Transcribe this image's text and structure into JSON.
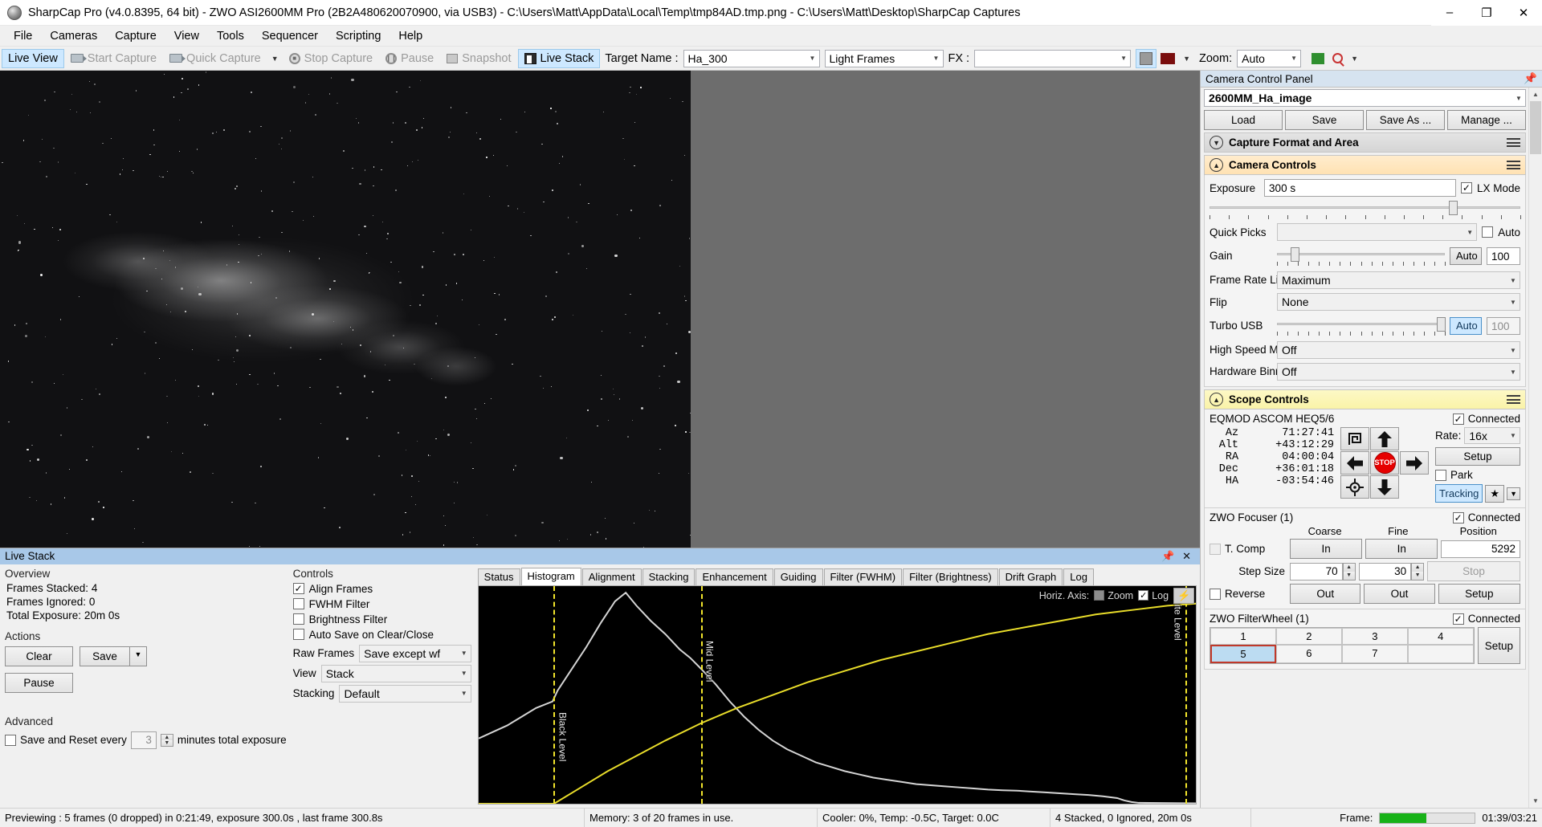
{
  "window": {
    "title": "SharpCap Pro (v4.0.8395, 64 bit) - ZWO ASI2600MM Pro (2B2A480620070900, via USB3) - C:\\Users\\Matt\\AppData\\Local\\Temp\\tmp84AD.tmp.png - C:\\Users\\Matt\\Desktop\\SharpCap Captures",
    "minimize": "–",
    "maximize": "❐",
    "close": "✕"
  },
  "menu": [
    "File",
    "Cameras",
    "Capture",
    "View",
    "Tools",
    "Sequencer",
    "Scripting",
    "Help"
  ],
  "toolbar": {
    "live_view": "Live View",
    "start_capture": "Start Capture",
    "quick_capture": "Quick Capture",
    "stop_capture": "Stop Capture",
    "pause": "Pause",
    "snapshot": "Snapshot",
    "live_stack": "Live Stack",
    "target_name_label": "Target Name :",
    "target_name_value": "Ha_300",
    "frame_type_value": "Light Frames",
    "fx_label": "FX :",
    "fx_value": "",
    "zoom_label": "Zoom:",
    "zoom_value": "Auto"
  },
  "live_stack": {
    "title": "Live Stack",
    "pin": "📌",
    "close": "✕",
    "overview": {
      "heading": "Overview",
      "frames_stacked_label": "Frames Stacked:",
      "frames_stacked_value": "4",
      "frames_ignored_label": "Frames Ignored:",
      "frames_ignored_value": "0",
      "total_exposure_label": "Total Exposure:",
      "total_exposure_value": "20m 0s"
    },
    "actions": {
      "heading": "Actions",
      "clear": "Clear",
      "save": "Save",
      "pause": "Pause"
    },
    "advanced": {
      "heading": "Advanced",
      "save_reset_label": "Save and Reset every",
      "minutes_value": "3",
      "minutes_suffix": "minutes total exposure",
      "save_reset_checked": false
    },
    "controls": {
      "heading": "Controls",
      "align_frames": "Align Frames",
      "align_frames_checked": true,
      "fwhm_filter": "FWHM Filter",
      "fwhm_filter_checked": false,
      "brightness_filter": "Brightness Filter",
      "brightness_filter_checked": false,
      "auto_save": "Auto Save on Clear/Close",
      "auto_save_checked": false,
      "raw_frames_label": "Raw Frames",
      "raw_frames_value": "Save except wf",
      "view_label": "View",
      "view_value": "Stack",
      "stacking_label": "Stacking",
      "stacking_value": "Default"
    },
    "tabs": [
      {
        "label": "Status",
        "active": false
      },
      {
        "label": "Histogram",
        "active": true
      },
      {
        "label": "Alignment",
        "active": false
      },
      {
        "label": "Stacking",
        "active": false
      },
      {
        "label": "Enhancement",
        "active": false
      },
      {
        "label": "Guiding",
        "active": false
      },
      {
        "label": "Filter (FWHM)",
        "active": false
      },
      {
        "label": "Filter (Brightness)",
        "active": false
      },
      {
        "label": "Drift Graph",
        "active": false
      },
      {
        "label": "Log",
        "active": false
      }
    ]
  },
  "chart_data": {
    "type": "line",
    "title": "Histogram",
    "xlabel": "",
    "ylabel": "",
    "grid": false,
    "legend": "none",
    "axis_controls": {
      "horiz_axis_label": "Horiz. Axis:",
      "zoom_label": "Zoom",
      "zoom_checked": false,
      "log_label": "Log",
      "log_checked": true,
      "lightning_button": "⚡"
    },
    "markers": [
      {
        "name": "Black Level",
        "x_pct": 10.5,
        "color": "#f2e52b"
      },
      {
        "name": "Mid Level",
        "x_pct": 31.0,
        "color": "#f2e52b"
      },
      {
        "name": "White Level",
        "x_pct": 98.5,
        "color": "#f2e52b"
      }
    ],
    "series": [
      {
        "name": "Histogram",
        "color": "#d5d5d5",
        "points": [
          [
            0,
            30
          ],
          [
            2,
            33
          ],
          [
            4,
            36
          ],
          [
            6,
            40
          ],
          [
            8,
            44
          ],
          [
            10.3,
            47
          ],
          [
            11,
            52
          ],
          [
            13,
            62
          ],
          [
            15,
            72
          ],
          [
            17,
            83
          ],
          [
            19,
            93
          ],
          [
            20.5,
            97
          ],
          [
            22,
            91
          ],
          [
            24,
            84
          ],
          [
            26,
            78
          ],
          [
            28,
            71
          ],
          [
            29.5,
            67
          ],
          [
            31,
            62
          ],
          [
            33,
            55
          ],
          [
            35,
            47
          ],
          [
            37,
            40
          ],
          [
            39,
            34
          ],
          [
            41,
            29
          ],
          [
            43,
            25
          ],
          [
            45,
            22
          ],
          [
            47,
            19
          ],
          [
            49,
            17
          ],
          [
            51,
            15
          ],
          [
            53,
            13.5
          ],
          [
            55,
            12
          ],
          [
            57,
            11
          ],
          [
            59,
            10
          ],
          [
            61,
            9
          ],
          [
            63,
            8.5
          ],
          [
            65,
            8
          ],
          [
            67,
            7.5
          ],
          [
            69,
            7
          ],
          [
            71,
            6.5
          ],
          [
            73,
            6.2
          ],
          [
            75,
            6
          ],
          [
            77,
            5.6
          ],
          [
            79,
            5.2
          ],
          [
            81,
            4.8
          ],
          [
            83,
            4.4
          ],
          [
            85,
            4
          ],
          [
            87,
            3.4
          ],
          [
            89,
            2.6
          ],
          [
            90,
            1.5
          ],
          [
            91,
            0.8
          ],
          [
            92,
            0.4
          ],
          [
            100,
            0.2
          ]
        ]
      },
      {
        "name": "Stretch Curve",
        "color": "#e9dd2a",
        "points": [
          [
            0,
            0
          ],
          [
            10.5,
            0
          ],
          [
            14,
            7
          ],
          [
            18,
            15
          ],
          [
            22,
            22
          ],
          [
            26,
            29
          ],
          [
            31,
            37
          ],
          [
            36,
            44
          ],
          [
            41,
            50
          ],
          [
            46,
            56
          ],
          [
            51,
            61
          ],
          [
            56,
            66
          ],
          [
            61,
            70
          ],
          [
            66,
            74
          ],
          [
            71,
            78
          ],
          [
            76,
            81
          ],
          [
            81,
            84
          ],
          [
            86,
            87
          ],
          [
            91,
            89
          ],
          [
            96,
            91
          ],
          [
            100,
            92
          ]
        ]
      }
    ]
  },
  "camera_panel": {
    "title": "Camera Control Panel",
    "pin": "📌",
    "profile_value": "2600MM_Ha_image",
    "profile_buttons": [
      "Load",
      "Save",
      "Save As ...",
      "Manage ..."
    ],
    "sections": {
      "capture_format": {
        "title": "Capture Format and Area",
        "expanded": false
      },
      "camera_controls": {
        "title": "Camera Controls",
        "expanded": true,
        "exposure_label": "Exposure",
        "exposure_value": "300 s",
        "lx_mode_label": "LX Mode",
        "lx_mode_checked": true,
        "quick_picks_label": "Quick Picks",
        "quick_picks_value": "",
        "quick_picks_auto_label": "Auto",
        "quick_picks_auto_checked": false,
        "gain_label": "Gain",
        "gain_auto": "Auto",
        "gain_value": "100",
        "frame_rate_label": "Frame Rate Limit",
        "frame_rate_value": "Maximum",
        "flip_label": "Flip",
        "flip_value": "None",
        "turbo_usb_label": "Turbo USB",
        "turbo_usb_auto": "Auto",
        "turbo_usb_value": "100",
        "high_speed_label": "High Speed Mode",
        "high_speed_value": "Off",
        "hw_binning_label": "Hardware Binning",
        "hw_binning_value": "Off"
      },
      "scope_controls": {
        "title": "Scope Controls",
        "expanded": true,
        "driver": "EQMOD ASCOM HEQ5/6",
        "connected_label": "Connected",
        "connected_checked": true,
        "coords": [
          {
            "label": "Az",
            "value": "71:27:41"
          },
          {
            "label": "Alt",
            "value": "+43:12:29"
          },
          {
            "label": "RA",
            "value": "04:00:04"
          },
          {
            "label": "Dec",
            "value": "+36:01:18"
          },
          {
            "label": "HA",
            "value": "-03:54:46"
          }
        ],
        "stop_label": "STOP",
        "rate_label": "Rate:",
        "rate_value": "16x",
        "setup_label": "Setup",
        "park_label": "Park",
        "park_checked": false,
        "tracking_label": "Tracking"
      },
      "focuser": {
        "title": "ZWO Focuser (1)",
        "connected_label": "Connected",
        "connected_checked": true,
        "col_coarse": "Coarse",
        "col_fine": "Fine",
        "col_position": "Position",
        "tcomp_label": "T. Comp",
        "tcomp_checked": false,
        "in_label": "In",
        "out_label": "Out",
        "position_value": "5292",
        "step_size_label": "Step Size",
        "step_coarse_value": "70",
        "step_fine_value": "30",
        "stop_label": "Stop",
        "reverse_label": "Reverse",
        "reverse_checked": false,
        "setup_label": "Setup"
      },
      "filterwheel": {
        "title": "ZWO FilterWheel (1)",
        "connected_label": "Connected",
        "connected_checked": true,
        "slots": [
          "1",
          "2",
          "3",
          "4",
          "5",
          "6",
          "7",
          ""
        ],
        "selected": "5",
        "setup_label": "Setup"
      }
    }
  },
  "statusbar": {
    "preview": "Previewing : 5 frames (0 dropped) in 0:21:49, exposure 300.0s , last frame 300.8s",
    "memory": "Memory: 3 of 20 frames in use.",
    "cooler": "Cooler: 0%, Temp: -0.5C, Target: 0.0C",
    "stack": "4 Stacked, 0 Ignored, 20m 0s",
    "frame_label": "Frame:",
    "frame_progress_pct": 49,
    "frame_time": "01:39/03:21"
  }
}
